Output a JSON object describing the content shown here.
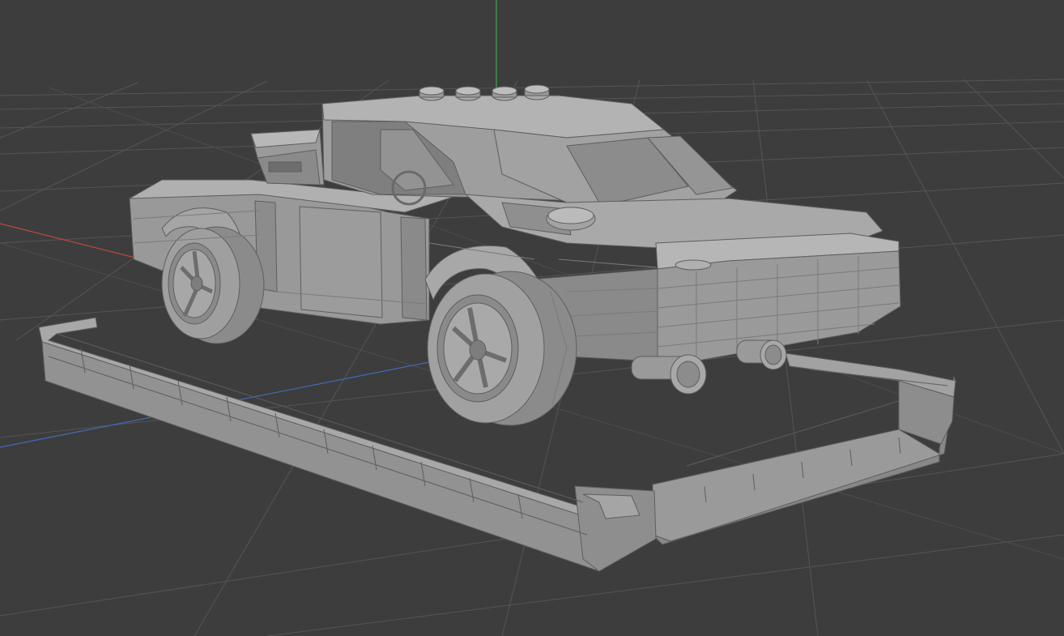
{
  "viewport": {
    "background": "#3d3d3d",
    "grid_color": "#555555",
    "grid_major_color": "#5a5a5a"
  },
  "axes": {
    "x_color": "#b54a3f",
    "y_color": "#3fa84c",
    "z_color": "#3f6cb5"
  },
  "model": {
    "base_color": "#8f8f8f",
    "light_color": "#a6a6a6",
    "dark_color": "#6e6e6e",
    "edge_color": "#5e5e5e"
  }
}
